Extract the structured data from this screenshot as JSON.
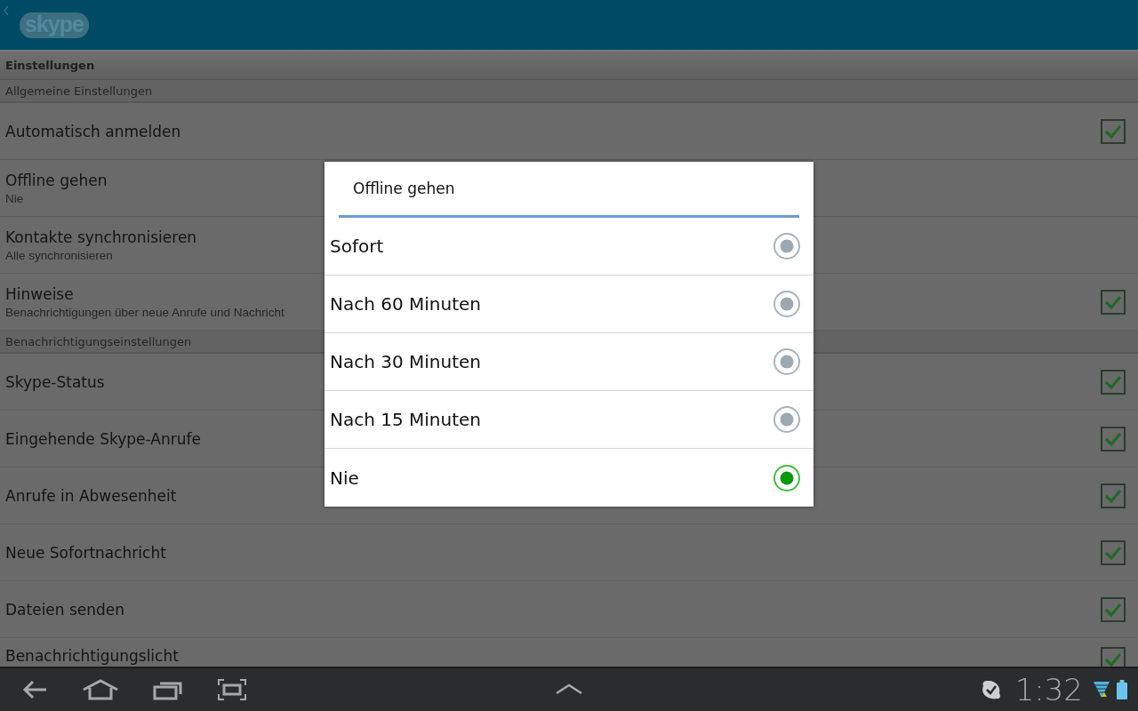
{
  "header": {
    "logo": "skype"
  },
  "category": "Einstellungen",
  "sections": [
    {
      "title": "Allgemeine Einstellungen",
      "items": [
        {
          "kind": "check",
          "title": "Automatisch anmelden",
          "checked": true
        },
        {
          "kind": "choice",
          "title": "Offline gehen",
          "summary": "Nie"
        },
        {
          "kind": "choice",
          "title": "Kontakte synchronisieren",
          "summary": "Alle synchronisieren"
        },
        {
          "kind": "check",
          "title": "Hinweise",
          "summary": "Benachrichtigungen über neue Anrufe und Nachricht",
          "checked": true
        }
      ]
    },
    {
      "title": "Benachrichtigungseinstellungen",
      "items": [
        {
          "kind": "check",
          "title": "Skype-Status",
          "checked": true
        },
        {
          "kind": "check",
          "title": "Eingehende Skype-Anrufe",
          "checked": true
        },
        {
          "kind": "check",
          "title": "Anrufe in Abwesenheit",
          "checked": true
        },
        {
          "kind": "check",
          "title": "Neue Sofortnachricht",
          "checked": true
        },
        {
          "kind": "check",
          "title": "Dateien senden",
          "checked": true
        },
        {
          "kind": "check",
          "title": "Benachrichtigungslicht",
          "checked": true
        }
      ]
    }
  ],
  "dialog": {
    "title": "Offline gehen",
    "options": [
      {
        "label": "Sofort",
        "selected": false
      },
      {
        "label": "Nach 60 Minuten",
        "selected": false
      },
      {
        "label": "Nach 30 Minuten",
        "selected": false
      },
      {
        "label": "Nach 15 Minuten",
        "selected": false
      },
      {
        "label": "Nie",
        "selected": true
      }
    ]
  },
  "status_bar": {
    "time": "1:32"
  }
}
